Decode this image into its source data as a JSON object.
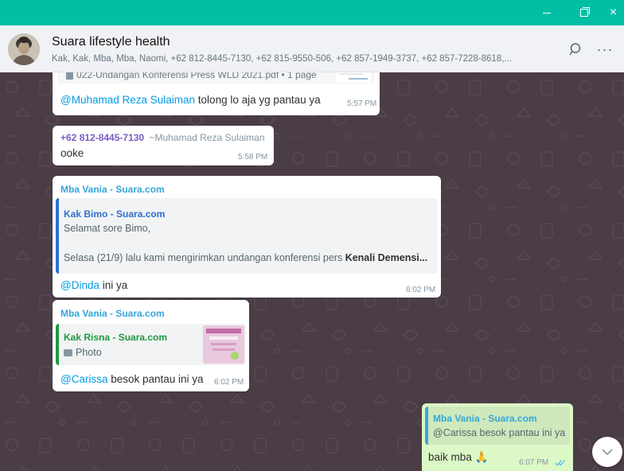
{
  "window": {
    "minimize_icon": "minimize-icon",
    "maximize_icon": "maximize-icon",
    "close_label": "×"
  },
  "header": {
    "group_name": "Suara lifestyle health",
    "participants": "Kak, Kak, Mba, Mba, Naomi, +62 812-8445-7130, +62 815-9550-506, +62 857-1949-3737, +62 857-7228-8618,...",
    "menu_label": "···",
    "search_icon": "search-icon"
  },
  "messages": {
    "m1": {
      "attachment": "022-Undangan Konferensi Press WLD 2021.pdf • 1 page",
      "mention": "@Muhamad Reza Sulaiman",
      "text": " tolong lo aja yg pantau ya",
      "time": "5:57 PM"
    },
    "m2": {
      "sender_phone": "+62 812-8445-7130",
      "sender_name": "~Muhamad Reza Sulaiman",
      "text": "ooke",
      "time": "5:58 PM"
    },
    "m3": {
      "sender": "Mba Vania - Suara.com",
      "quote_sender": "Kak Bimo - Suara.com",
      "quote_line1": "Selamat sore Bimo,",
      "quote_line2_plain": "Selasa (21/9) lalu kami mengirimkan undangan konferensi pers ",
      "quote_line2_bold": "Kenali Demensi...",
      "mention": "@Dinda",
      "text": " ini ya",
      "time": "6:02 PM"
    },
    "m4": {
      "sender": "Mba Vania - Suara.com",
      "quote_sender": "Kak Risna - Suara.com",
      "quote_text": "Photo",
      "mention": "@Carissa",
      "text": " besok pantau ini ya",
      "time": "6:02 PM"
    },
    "m5": {
      "quote_sender": "Mba Vania - Suara.com",
      "quote_text": "@Carissa besok pantau ini ya",
      "text": "baik mba 🙏",
      "time": "6:07 PM"
    }
  },
  "colors": {
    "title_bar": "#00bfa5",
    "chat_bg": "#4a3d46",
    "out_bubble": "#dcf8c6",
    "mention": "#039be5",
    "sender_vania": "#35a6d8",
    "sender_bimo": "#2f6fd1",
    "sender_risna": "#1c9b3e",
    "sender_phone": "#7a5cc4"
  }
}
